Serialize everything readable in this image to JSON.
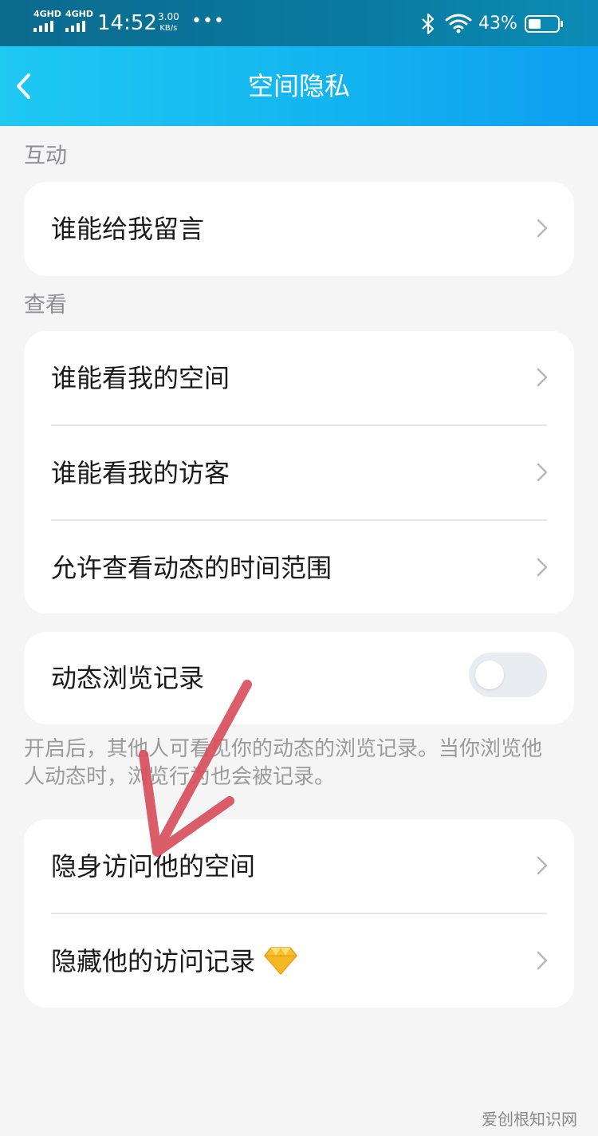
{
  "status_bar": {
    "network_1": "4GHD",
    "network_2": "4GHD",
    "time": "14:52",
    "speed_value": "3.00",
    "speed_unit": "KB/s",
    "more": "•••",
    "battery_percent": "43%",
    "battery_level": 0.43,
    "icons": [
      "signal-icon",
      "signal-icon",
      "bluetooth-icon",
      "wifi-icon",
      "battery-icon"
    ]
  },
  "nav": {
    "back_icon": "back-chevron-icon",
    "title": "空间隐私"
  },
  "sections": {
    "interaction_label": "互动",
    "view_label": "查看"
  },
  "interaction": {
    "who_can_message": "谁能给我留言"
  },
  "view": {
    "who_can_view_space": "谁能看我的空间",
    "who_can_view_visitors": "谁能看我的访客",
    "allowed_time_range": "允许查看动态的时间范围"
  },
  "browse_record": {
    "label": "动态浏览记录",
    "enabled": false,
    "hint": "开启后，其他人可看见你的动态的浏览记录。当你浏览他人动态时，浏览行为也会被记录。"
  },
  "privacy": {
    "invisible_visit": "隐身访问他的空间",
    "hide_visit_record": "隐藏他的访问记录",
    "vip_icon": "diamond-icon"
  },
  "colors": {
    "nav_gradient_start": "#1ec9f2",
    "nav_gradient_end": "#0d9ff0",
    "status_bar": "#0b7aa0",
    "background": "#f5f5f5",
    "annotation_arrow": "#d9505e",
    "diamond": "#f6c02c"
  },
  "watermark": "爱创根知识网"
}
